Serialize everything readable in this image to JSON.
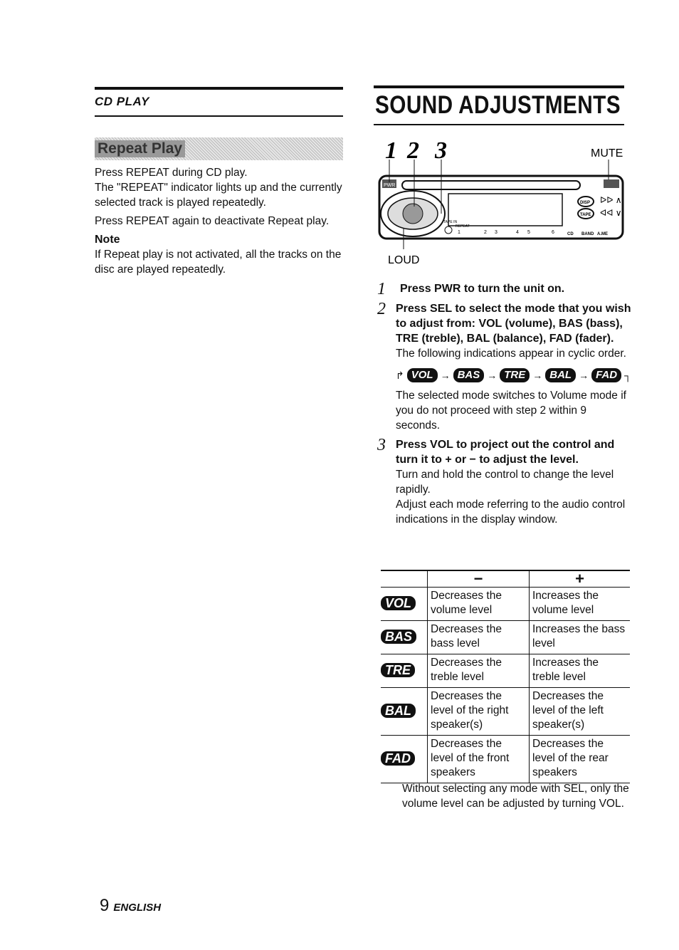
{
  "left": {
    "section": "CD PLAY",
    "banner": "Repeat Play",
    "para1": "Press REPEAT during CD play.",
    "para2": "The \"REPEAT\" indicator lights up and the currently selected track is played repeatedly.",
    "para3": "Press REPEAT again to deactivate Repeat play.",
    "note_heading": "Note",
    "note_text": "If Repeat play is not activated, all the tracks on the disc are played repeatedly."
  },
  "right": {
    "title": "SOUND ADJUSTMENTS",
    "figure": {
      "n1": "1",
      "n2": "2",
      "n3": "3",
      "mute": "MUTE",
      "loud": "LOUD",
      "pwr": "PWR",
      "disp": "DISP",
      "tape": "TAPE",
      "cd": "CD",
      "band": "BAND",
      "ame": "A.ME",
      "tape_in": "TAPE IN",
      "repeat": "REPEAT",
      "presets": [
        "1",
        "2",
        "3",
        "4",
        "5",
        "6"
      ]
    },
    "steps": [
      {
        "num": "1",
        "heading": "Press PWR to turn the unit on.",
        "body": []
      },
      {
        "num": "2",
        "heading": "Press SEL to select the mode that you wish to adjust from: VOL (volume), BAS (bass), TRE (treble), BAL (balance), FAD (fader).",
        "body": [
          "The following indications appear in cyclic order."
        ]
      },
      {
        "num": "3",
        "heading": "Press VOL to project out the control and turn it to + or − to adjust the level.",
        "body": [
          "Turn and hold the control to change the level rapidly.",
          "Adjust each mode referring to the audio control indications in the display window."
        ]
      }
    ],
    "cycle": [
      "VOL",
      "BAS",
      "TRE",
      "BAL",
      "FAD"
    ],
    "cycle_note": "The selected mode switches to Volume mode if you do not proceed with step 2 within 9 seconds.",
    "table": {
      "headers": [
        "",
        "−",
        "+"
      ],
      "rows": [
        {
          "mode": "VOL",
          "minus": "Decreases the volume level",
          "plus": "Increases the volume level"
        },
        {
          "mode": "BAS",
          "minus": "Decreases the bass level",
          "plus": "Increases the bass level"
        },
        {
          "mode": "TRE",
          "minus": "Decreases the treble level",
          "plus": "Increases the treble level"
        },
        {
          "mode": "BAL",
          "minus": "Decreases the level of the right speaker(s)",
          "plus": "Decreases the level of the left speaker(s)"
        },
        {
          "mode": "FAD",
          "minus": "Decreases the level of the front speakers",
          "plus": "Decreases the level of the rear speakers"
        }
      ]
    },
    "footnote": "Without selecting any mode with SEL, only the volume level can be adjusted by turning VOL."
  },
  "footer": {
    "page": "9",
    "lang": "ENGLISH"
  }
}
